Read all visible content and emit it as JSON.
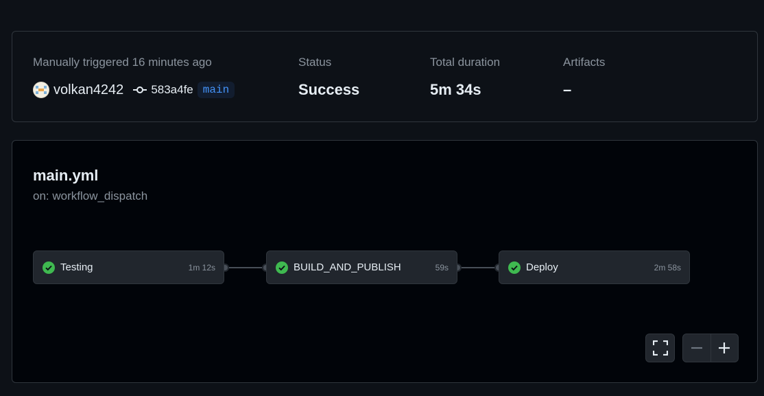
{
  "summary": {
    "trigger_label": "Manually triggered 16 minutes ago",
    "user": "volkan4242",
    "commit_sha": "583a4fe",
    "branch": "main",
    "status_label": "Status",
    "status_value": "Success",
    "duration_label": "Total duration",
    "duration_value": "5m 34s",
    "artifacts_label": "Artifacts",
    "artifacts_value": "–"
  },
  "workflow": {
    "file": "main.yml",
    "trigger": "on: workflow_dispatch",
    "jobs": [
      {
        "name": "Testing",
        "duration": "1m 12s",
        "status": "success"
      },
      {
        "name": "BUILD_AND_PUBLISH",
        "duration": "59s",
        "status": "success"
      },
      {
        "name": "Deploy",
        "duration": "2m 58s",
        "status": "success"
      }
    ]
  },
  "colors": {
    "success": "#3fb950",
    "branch_text": "#4493f8",
    "background": "#0d1117",
    "graph_background": "#010409"
  },
  "icons": {
    "job_status": "check-circle-icon",
    "commit": "git-commit-icon",
    "fullscreen": "fullscreen-icon",
    "zoom_out": "minus-icon",
    "zoom_in": "plus-icon"
  }
}
